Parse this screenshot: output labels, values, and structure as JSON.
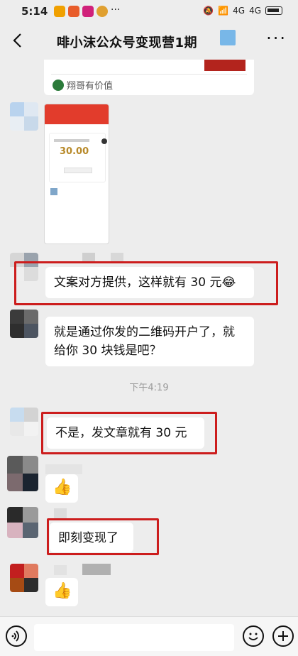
{
  "status_bar": {
    "time": "5:14",
    "signal_1": "4G",
    "signal_2": "4G"
  },
  "nav": {
    "back_icon": "chevron-left-icon",
    "title": "啡小沫公众号变现营1期",
    "more_icon": "more-dots-icon"
  },
  "card_fragment": {
    "source_label": "翔哥有价值"
  },
  "screenshot_card": {
    "amount": "30.00"
  },
  "messages": [
    {
      "text": "文案对方提供，这样就有 30 元😂"
    },
    {
      "text_line1": "就是通过你发的二维码开户了，就",
      "text_line2": "给你 30 块钱是吧？"
    },
    {
      "text": "不是，发文章就有 30 元"
    },
    {
      "text": "👍"
    },
    {
      "text": "即刻变现了"
    },
    {
      "text": "👍"
    }
  ],
  "timestamp": "下午4:19",
  "input_bar": {
    "voice_icon": "voice-icon",
    "emoji_icon": "emoji-icon",
    "add_icon": "plus-icon"
  },
  "colors": {
    "highlight": "#cc1d1d",
    "chat_bg": "#ededed",
    "bubble": "#ffffff"
  }
}
